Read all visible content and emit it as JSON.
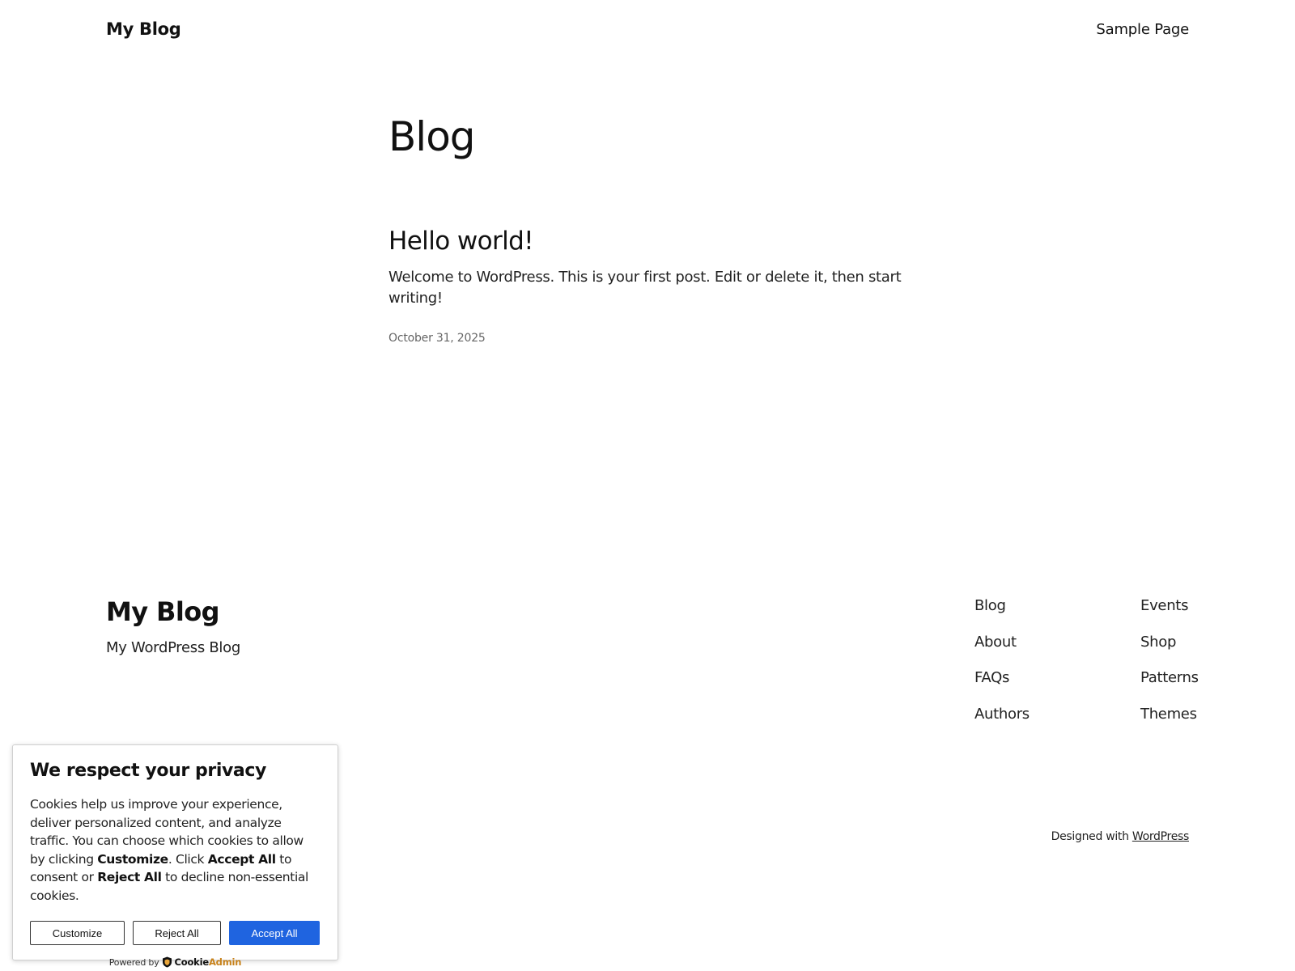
{
  "header": {
    "site_title": "My Blog",
    "nav": [
      {
        "label": "Sample Page"
      }
    ]
  },
  "main": {
    "heading": "Blog",
    "post": {
      "title": "Hello world!",
      "excerpt": "Welcome to WordPress. This is your first post. Edit or delete it, then start writing!",
      "date": "October 31, 2025"
    }
  },
  "footer": {
    "title": "My Blog",
    "tagline": "My WordPress Blog",
    "nav_col_1": [
      {
        "label": "Blog"
      },
      {
        "label": "About"
      },
      {
        "label": "FAQs"
      },
      {
        "label": "Authors"
      }
    ],
    "nav_col_2": [
      {
        "label": "Events"
      },
      {
        "label": "Shop"
      },
      {
        "label": "Patterns"
      },
      {
        "label": "Themes"
      }
    ],
    "credit_prefix": "Designed with",
    "credit_link": "WordPress"
  },
  "cookie_banner": {
    "title": "We respect your privacy",
    "text_1": "Cookies help us improve your experience, deliver personalized content, and analyze traffic. You can choose which cookies to allow by clicking ",
    "text_customize": "Customize",
    "text_2": ". Click ",
    "text_accept": "Accept All",
    "text_3": " to consent or ",
    "text_reject": "Reject All",
    "text_4": " to decline non-essential cookies.",
    "buttons": {
      "customize": "Customize",
      "reject": "Reject All",
      "accept": "Accept All"
    },
    "powered_by": "Powered by",
    "brand_part_1": "Cookie",
    "brand_part_2": "Admin",
    "brand_icon": "shield-icon",
    "accept_color": "#1f64e0",
    "brand_accent_color": "#c8821a"
  }
}
